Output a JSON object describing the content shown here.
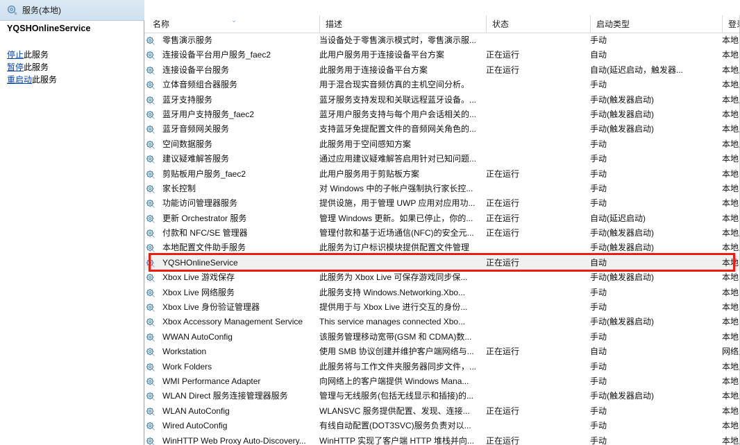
{
  "window": {
    "tree_header_title": "服务(本地)",
    "tree_header_icon": "services-gear-icon"
  },
  "details_pane": {
    "service_title": "YQSHOnlineService",
    "links": [
      {
        "name": "stop-service-link",
        "link_text": "停止",
        "suffix": "此服务"
      },
      {
        "name": "pause-service-link",
        "link_text": "暂停",
        "suffix": "此服务"
      },
      {
        "name": "restart-service-link",
        "link_text": "重启动",
        "suffix": "此服务"
      }
    ]
  },
  "table": {
    "columns": [
      {
        "key": "name",
        "label": "名称",
        "sorted": true
      },
      {
        "key": "desc",
        "label": "描述",
        "sorted": false
      },
      {
        "key": "state",
        "label": "状态",
        "sorted": false
      },
      {
        "key": "start",
        "label": "启动类型",
        "sorted": false
      },
      {
        "key": "logon",
        "label": "登录为",
        "sorted": false
      }
    ],
    "sort_caret": "⌄",
    "rows": [
      {
        "name": "零售演示服务",
        "desc": "当设备处于零售演示模式时，零售演示服...",
        "state": "",
        "start": "手动",
        "logon": "本地系统",
        "selected": false
      },
      {
        "name": "连接设备平台用户服务_faec2",
        "desc": "此用户服务用于连接设备平台方案",
        "state": "正在运行",
        "start": "自动",
        "logon": "本地系统",
        "selected": false
      },
      {
        "name": "连接设备平台服务",
        "desc": "此服务用于连接设备平台方案",
        "state": "正在运行",
        "start": "自动(延迟启动，触发器...",
        "logon": "本地服务",
        "selected": false
      },
      {
        "name": "立体音频组合器服务",
        "desc": "用于混合现实音频仿真的主机空间分析。",
        "state": "",
        "start": "手动",
        "logon": "本地服务",
        "selected": false
      },
      {
        "name": "蓝牙支持服务",
        "desc": "蓝牙服务支持发现和关联远程蓝牙设备。...",
        "state": "",
        "start": "手动(触发器启动)",
        "logon": "本地服务",
        "selected": false
      },
      {
        "name": "蓝牙用户支持服务_faec2",
        "desc": "蓝牙用户服务支持与每个用户会话相关的...",
        "state": "",
        "start": "手动(触发器启动)",
        "logon": "本地系统",
        "selected": false
      },
      {
        "name": "蓝牙音频网关服务",
        "desc": "支持蓝牙免提配置文件的音频网关角色的...",
        "state": "",
        "start": "手动(触发器启动)",
        "logon": "本地服务",
        "selected": false
      },
      {
        "name": "空间数据服务",
        "desc": "此服务用于空间感知方案",
        "state": "",
        "start": "手动",
        "logon": "本地服务",
        "selected": false
      },
      {
        "name": "建议疑难解答服务",
        "desc": "通过应用建议疑难解答启用针对已知问题...",
        "state": "",
        "start": "手动",
        "logon": "本地系统",
        "selected": false
      },
      {
        "name": "剪贴板用户服务_faec2",
        "desc": "此用户服务用于剪贴板方案",
        "state": "正在运行",
        "start": "手动",
        "logon": "本地系统",
        "selected": false
      },
      {
        "name": "家长控制",
        "desc": "对 Windows 中的子帐户强制执行家长控...",
        "state": "",
        "start": "手动",
        "logon": "本地系统",
        "selected": false
      },
      {
        "name": "功能访问管理器服务",
        "desc": "提供设施，用于管理 UWP 应用对应用功...",
        "state": "正在运行",
        "start": "手动",
        "logon": "本地系统",
        "selected": false
      },
      {
        "name": "更新 Orchestrator 服务",
        "desc": "管理 Windows 更新。如果已停止，你的...",
        "state": "正在运行",
        "start": "自动(延迟启动)",
        "logon": "本地系统",
        "selected": false
      },
      {
        "name": "付款和 NFC/SE 管理器",
        "desc": "管理付款和基于近场通信(NFC)的安全元...",
        "state": "正在运行",
        "start": "手动(触发器启动)",
        "logon": "本地服务",
        "selected": false
      },
      {
        "name": "本地配置文件助手服务",
        "desc": "此服务为订户标识模块提供配置文件管理",
        "state": "",
        "start": "手动(触发器启动)",
        "logon": "本地服务",
        "selected": false
      },
      {
        "name": "YQSHOnlineService",
        "desc": "",
        "state": "正在运行",
        "start": "自动",
        "logon": "本地系统",
        "selected": true
      },
      {
        "name": "Xbox Live 游戏保存",
        "desc": "此服务为 Xbox Live 可保存游戏同步保...",
        "state": "",
        "start": "手动(触发器启动)",
        "logon": "本地系统",
        "selected": false
      },
      {
        "name": "Xbox Live 网络服务",
        "desc": "此服务支持 Windows.Networking.Xbo...",
        "state": "",
        "start": "手动",
        "logon": "本地系统",
        "selected": false
      },
      {
        "name": "Xbox Live 身份验证管理器",
        "desc": "提供用于与 Xbox Live 进行交互的身份...",
        "state": "",
        "start": "手动",
        "logon": "本地系统",
        "selected": false
      },
      {
        "name": "Xbox Accessory Management Service",
        "desc": "This service manages connected Xbo...",
        "state": "",
        "start": "手动(触发器启动)",
        "logon": "本地系统",
        "selected": false
      },
      {
        "name": "WWAN AutoConfig",
        "desc": "该服务管理移动宽带(GSM 和 CDMA)数...",
        "state": "",
        "start": "手动",
        "logon": "本地系统",
        "selected": false
      },
      {
        "name": "Workstation",
        "desc": "使用 SMB 协议创建并维护客户端网络与...",
        "state": "正在运行",
        "start": "自动",
        "logon": "网络服务",
        "selected": false
      },
      {
        "name": "Work Folders",
        "desc": "此服务将与工作文件夹服务器同步文件，...",
        "state": "",
        "start": "手动",
        "logon": "本地服务",
        "selected": false
      },
      {
        "name": "WMI Performance Adapter",
        "desc": "向网络上的客户端提供 Windows Mana...",
        "state": "",
        "start": "手动",
        "logon": "本地系统",
        "selected": false
      },
      {
        "name": "WLAN Direct 服务连接管理器服务",
        "desc": "管理与无线服务(包括无线显示和插接)的...",
        "state": "",
        "start": "手动(触发器启动)",
        "logon": "本地服务",
        "selected": false
      },
      {
        "name": "WLAN AutoConfig",
        "desc": "WLANSVC 服务提供配置、发现、连接...",
        "state": "正在运行",
        "start": "手动",
        "logon": "本地系统",
        "selected": false
      },
      {
        "name": "Wired AutoConfig",
        "desc": "有线自动配置(DOT3SVC)服务负责对以...",
        "state": "",
        "start": "手动",
        "logon": "本地系统",
        "selected": false
      },
      {
        "name": "WinHTTP Web Proxy Auto-Discovery...",
        "desc": "WinHTTP 实现了客户端 HTTP 堆栈并向...",
        "state": "正在运行",
        "start": "手动",
        "logon": "本地服务",
        "selected": false
      }
    ]
  },
  "annotation": {
    "highlight_color": "#ee1b11",
    "highlight_target": "YQSHOnlineService"
  }
}
